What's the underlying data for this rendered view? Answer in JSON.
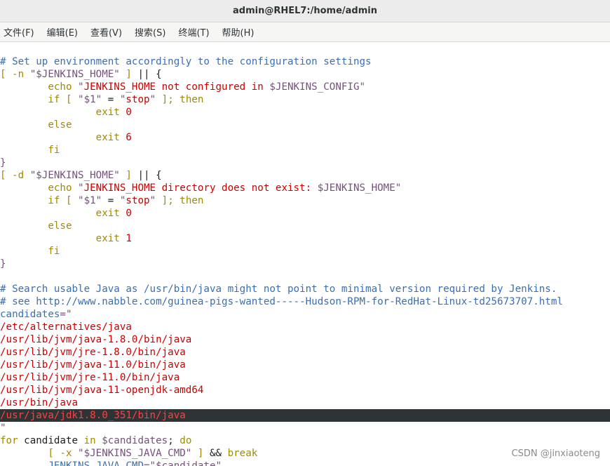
{
  "window": {
    "title": "admin@RHEL7:/home/admin"
  },
  "menu": [
    {
      "label": "文件(F)"
    },
    {
      "label": "编辑(E)"
    },
    {
      "label": "查看(V)"
    },
    {
      "label": "搜索(S)"
    },
    {
      "label": "终端(T)"
    },
    {
      "label": "帮助(H)"
    }
  ],
  "colors": {
    "comment": "#3b6fb0",
    "keyword": "#a28a00",
    "string": "#cc0000",
    "variable": "#75507b",
    "text": "#1e1e1e",
    "highlight_bg": "#2e3436",
    "highlight_fg": "#ff4040"
  },
  "terminal": {
    "lines": [
      {
        "segments": []
      },
      {
        "segments": [
          {
            "t": "# Set up environment accordingly to the configuration settings",
            "c": "comment"
          }
        ]
      },
      {
        "segments": [
          {
            "t": "[ -n ",
            "c": "keyword"
          },
          {
            "t": "\"$JENKINS_HOME\"",
            "c": "variable"
          },
          {
            "t": " ] ",
            "c": "keyword"
          },
          {
            "t": "|| {",
            "c": "text"
          }
        ]
      },
      {
        "segments": [
          {
            "t": "        echo ",
            "c": "keyword"
          },
          {
            "t": "\"",
            "c": "variable"
          },
          {
            "t": "JENKINS_HOME not configured in ",
            "c": "string"
          },
          {
            "t": "$JENKINS_CONFIG\"",
            "c": "variable"
          }
        ]
      },
      {
        "segments": [
          {
            "t": "        if [ ",
            "c": "keyword"
          },
          {
            "t": "\"$1\"",
            "c": "variable"
          },
          {
            "t": " = ",
            "c": "text"
          },
          {
            "t": "\"",
            "c": "variable"
          },
          {
            "t": "stop",
            "c": "string"
          },
          {
            "t": "\"",
            "c": "variable"
          },
          {
            "t": " ]; then",
            "c": "keyword"
          }
        ]
      },
      {
        "segments": [
          {
            "t": "                exit ",
            "c": "keyword"
          },
          {
            "t": "0",
            "c": "string"
          }
        ]
      },
      {
        "segments": [
          {
            "t": "        else",
            "c": "keyword"
          }
        ]
      },
      {
        "segments": [
          {
            "t": "                exit ",
            "c": "keyword"
          },
          {
            "t": "6",
            "c": "string"
          }
        ]
      },
      {
        "segments": [
          {
            "t": "        fi",
            "c": "keyword"
          }
        ]
      },
      {
        "segments": [
          {
            "t": "}",
            "c": "variable"
          }
        ]
      },
      {
        "segments": [
          {
            "t": "[ -d ",
            "c": "keyword"
          },
          {
            "t": "\"$JENKINS_HOME\"",
            "c": "variable"
          },
          {
            "t": " ] ",
            "c": "keyword"
          },
          {
            "t": "|| {",
            "c": "text"
          }
        ]
      },
      {
        "segments": [
          {
            "t": "        echo ",
            "c": "keyword"
          },
          {
            "t": "\"",
            "c": "variable"
          },
          {
            "t": "JENKINS_HOME directory does not exist: ",
            "c": "string"
          },
          {
            "t": "$JENKINS_HOME\"",
            "c": "variable"
          }
        ]
      },
      {
        "segments": [
          {
            "t": "        if [ ",
            "c": "keyword"
          },
          {
            "t": "\"$1\"",
            "c": "variable"
          },
          {
            "t": " = ",
            "c": "text"
          },
          {
            "t": "\"",
            "c": "variable"
          },
          {
            "t": "stop",
            "c": "string"
          },
          {
            "t": "\"",
            "c": "variable"
          },
          {
            "t": " ]; then",
            "c": "keyword"
          }
        ]
      },
      {
        "segments": [
          {
            "t": "                exit ",
            "c": "keyword"
          },
          {
            "t": "0",
            "c": "string"
          }
        ]
      },
      {
        "segments": [
          {
            "t": "        else",
            "c": "keyword"
          }
        ]
      },
      {
        "segments": [
          {
            "t": "                exit ",
            "c": "keyword"
          },
          {
            "t": "1",
            "c": "string"
          }
        ]
      },
      {
        "segments": [
          {
            "t": "        fi",
            "c": "keyword"
          }
        ]
      },
      {
        "segments": [
          {
            "t": "}",
            "c": "variable"
          }
        ]
      },
      {
        "segments": []
      },
      {
        "segments": [
          {
            "t": "# Search usable Java as /usr/bin/java might not point to minimal version required by Jenkins.",
            "c": "comment"
          }
        ]
      },
      {
        "segments": [
          {
            "t": "# see http://www.nabble.com/guinea-pigs-wanted-----Hudson-RPM-for-RedHat-Linux-td25673707.html",
            "c": "comment"
          }
        ]
      },
      {
        "segments": [
          {
            "t": "candidates",
            "c": "comment"
          },
          {
            "t": "=\"",
            "c": "variable"
          }
        ]
      },
      {
        "segments": [
          {
            "t": "/etc/alternatives/java",
            "c": "string"
          }
        ]
      },
      {
        "segments": [
          {
            "t": "/usr/lib/jvm/java-1.8.0/bin/java",
            "c": "string"
          }
        ]
      },
      {
        "segments": [
          {
            "t": "/usr/lib/jvm/jre-1.8.0/bin/java",
            "c": "string"
          }
        ]
      },
      {
        "segments": [
          {
            "t": "/usr/lib/jvm/java-11.0/bin/java",
            "c": "string"
          }
        ]
      },
      {
        "segments": [
          {
            "t": "/usr/lib/jvm/jre-11.0/bin/java",
            "c": "string"
          }
        ]
      },
      {
        "segments": [
          {
            "t": "/usr/lib/jvm/java-11-openjdk-amd64",
            "c": "string"
          }
        ]
      },
      {
        "segments": [
          {
            "t": "/usr/bin/java",
            "c": "string"
          }
        ]
      },
      {
        "highlight": true,
        "segments": [
          {
            "t": "/usr/java/jdk1.8.0_351/bin/java",
            "c": "highlight_fg"
          }
        ]
      },
      {
        "segments": [
          {
            "t": "\"",
            "c": "variable"
          }
        ]
      },
      {
        "segments": [
          {
            "t": "for",
            "c": "keyword"
          },
          {
            "t": " candidate ",
            "c": "text"
          },
          {
            "t": "in",
            "c": "keyword"
          },
          {
            "t": " $candidates",
            "c": "variable"
          },
          {
            "t": "; ",
            "c": "text"
          },
          {
            "t": "do",
            "c": "keyword"
          }
        ]
      },
      {
        "segments": [
          {
            "t": "        [ -x ",
            "c": "keyword"
          },
          {
            "t": "\"$JENKINS_JAVA_CMD\"",
            "c": "variable"
          },
          {
            "t": " ] ",
            "c": "keyword"
          },
          {
            "t": "&& ",
            "c": "text"
          },
          {
            "t": "break",
            "c": "keyword"
          }
        ]
      },
      {
        "segments": [
          {
            "t": "        JENKINS_JAVA_CMD",
            "c": "comment"
          },
          {
            "t": "=\"$candidate\"",
            "c": "variable"
          }
        ]
      }
    ]
  },
  "watermark": "CSDN @jinxiaoteng"
}
